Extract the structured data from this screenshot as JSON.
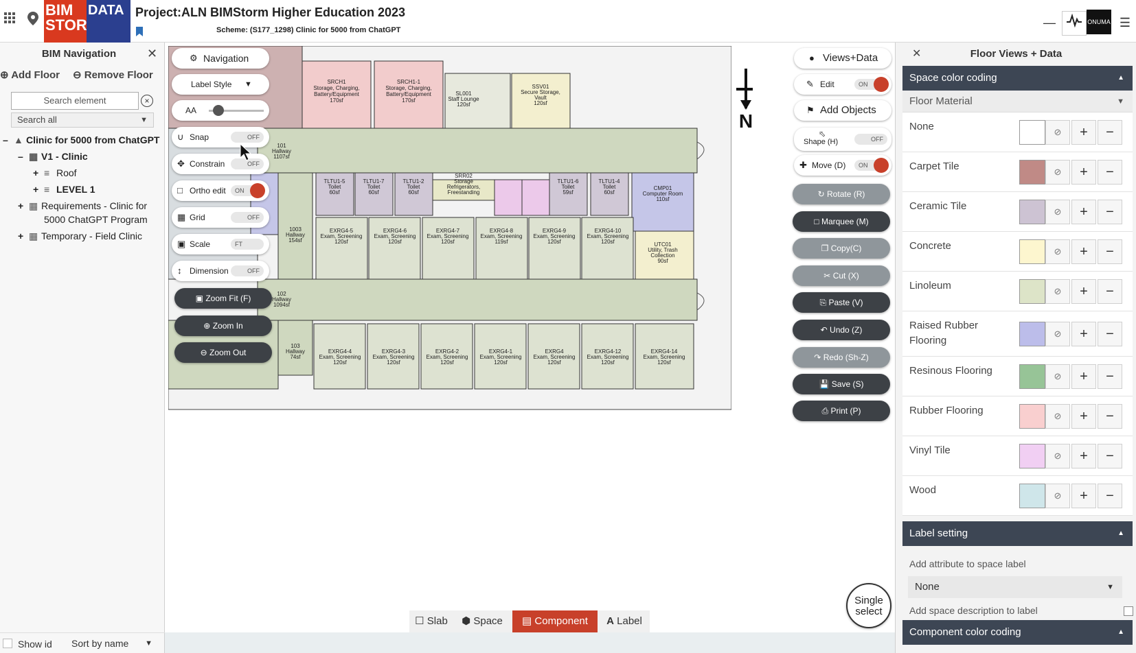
{
  "header": {
    "project_title": "Project:ALN BIMStorm Higher Education 2023",
    "scheme": "Scheme: (S177_1298) Clinic for 5000 from ChatGPT",
    "logo_left": "BIM STORM",
    "logo_right": "DATA",
    "right_logo": "ONUMA"
  },
  "bim_navigation": {
    "title": "BIM Navigation",
    "add_floor": "Add Floor",
    "remove_floor": "Remove Floor",
    "search_placeholder": "Search element",
    "search_scope": "Search all",
    "tree": [
      {
        "toggle": "–",
        "label": "Clinic for 5000 from ChatGPT",
        "bold": true
      },
      {
        "toggle": "–",
        "label": "V1 - Clinic",
        "bold": true
      },
      {
        "toggle": "+",
        "label": "Roof",
        "bold": false
      },
      {
        "toggle": "+",
        "label": "LEVEL 1",
        "bold": true
      },
      {
        "toggle": "+",
        "label": "Requirements - Clinic for",
        "label2": "5000 ChatGPT Program",
        "bold": false
      },
      {
        "toggle": "+",
        "label": "Temporary - Field Clinic",
        "bold": false
      }
    ],
    "show_id": "Show id",
    "sort_by": "Sort by name"
  },
  "left_toolbar": {
    "navigation": "Navigation",
    "label_style": "Label Style",
    "font_size_label": "AA",
    "snap": {
      "label": "Snap",
      "state": "OFF"
    },
    "constrain": {
      "label": "Constrain",
      "state": "OFF"
    },
    "ortho_edit": {
      "label": "Ortho edit",
      "state": "ON"
    },
    "grid": {
      "label": "Grid",
      "state": "OFF"
    },
    "scale": {
      "label": "Scale",
      "state": "FT"
    },
    "dimension": {
      "label": "Dimension",
      "state": "OFF"
    },
    "zoom_fit": "Zoom Fit (F)",
    "zoom_in": "Zoom In",
    "zoom_out": "Zoom Out"
  },
  "right_toolbar": {
    "views_data": "Views+Data",
    "edit": {
      "label": "Edit",
      "state": "ON"
    },
    "add_objects": "Add Objects",
    "shape": {
      "label": "Shape (H)",
      "state": "OFF"
    },
    "move": {
      "label": "Move (D)",
      "state": "ON"
    },
    "rotate": "Rotate (R)",
    "marquee": "Marquee (M)",
    "copy": "Copy(C)",
    "cut": "Cut (X)",
    "paste": "Paste (V)",
    "undo": "Undo (Z)",
    "redo": "Redo (Sh-Z)",
    "save": "Save (S)",
    "print": "Print (P)"
  },
  "single_select": {
    "line1": "Single",
    "line2": "select"
  },
  "mode_bar": [
    {
      "label": "Slab",
      "active": false
    },
    {
      "label": "Space",
      "active": false
    },
    {
      "label": "Component",
      "active": true
    },
    {
      "label": "Label",
      "active": false
    }
  ],
  "north_label": "N",
  "floorplan": {
    "rooms": [
      {
        "id": "SRCH1",
        "line2": "Storage, Charging,",
        "line3": "Battery/Equipment",
        "line4": "170sf"
      },
      {
        "id": "SRCH1-1",
        "line2": "Storage, Charging,",
        "line3": "Battery/Equipment",
        "line4": "170sf"
      },
      {
        "id": "SL001",
        "line2": "Staff Lounge",
        "line3": "120sf"
      },
      {
        "id": "SSV01",
        "line2": "Secure Storage,",
        "line3": "Vault",
        "line4": "120sf"
      },
      {
        "id": "101",
        "line2": "Hallway",
        "line3": "1107sf"
      },
      {
        "id": "TLTU1-5",
        "line2": "Toilet",
        "line3": "60sf"
      },
      {
        "id": "TLTU1-7",
        "line2": "Toilet",
        "line3": "60sf"
      },
      {
        "id": "TLTU1-2",
        "line2": "Toilet",
        "line3": "60sf"
      },
      {
        "id": "SRR02",
        "line2": "Storage",
        "line3": "Refrigerators,",
        "line4": "Freestanding"
      },
      {
        "id": "TLTU1-6",
        "line2": "Toilet",
        "line3": "59sf"
      },
      {
        "id": "TLTU1-4",
        "line2": "Toilet",
        "line3": "60sf"
      },
      {
        "id": "CMP01",
        "line2": "Computer Room",
        "line3": "110sf"
      },
      {
        "id": "1003",
        "line2": "Hallway",
        "line3": "154sf"
      },
      {
        "id": "EXRG4-5",
        "line2": "Exam, Screening",
        "line3": "120sf"
      },
      {
        "id": "EXRG4-6",
        "line2": "Exam, Screening",
        "line3": "120sf"
      },
      {
        "id": "EXRG4-7",
        "line2": "Exam, Screening",
        "line3": "120sf"
      },
      {
        "id": "EXRG4-8",
        "line2": "Exam, Screening",
        "line3": "119sf"
      },
      {
        "id": "EXRG4-9",
        "line2": "Exam, Screening",
        "line3": "120sf"
      },
      {
        "id": "EXRG4-10",
        "line2": "Exam, Screening",
        "line3": "120sf"
      },
      {
        "id": "UTC01",
        "line2": "Utility, Trash",
        "line3": "Collection",
        "line4": "90sf"
      },
      {
        "id": "102",
        "line2": "Hallway",
        "line3": "1094sf"
      },
      {
        "id": "103",
        "line2": "Hallway",
        "line3": "74sf"
      },
      {
        "id": "EXRG4-4",
        "line2": "Exam, Screening",
        "line3": "120sf"
      },
      {
        "id": "EXRG4-3",
        "line2": "Exam, Screening",
        "line3": "120sf"
      },
      {
        "id": "EXRG4-2",
        "line2": "Exam, Screening",
        "line3": "120sf"
      },
      {
        "id": "EXRG4-1",
        "line2": "Exam, Screening",
        "line3": "120sf"
      },
      {
        "id": "EXRG4",
        "line2": "Exam, Screening",
        "line3": "120sf"
      },
      {
        "id": "EXRG4-12",
        "line2": "Exam, Screening",
        "line3": "120sf"
      },
      {
        "id": "EXRG4-14",
        "line2": "Exam, Screening",
        "line3": "120sf"
      }
    ]
  },
  "floor_views": {
    "title": "Floor Views + Data",
    "space_color_coding": "Space color coding",
    "floor_material": "Floor Material",
    "materials": [
      {
        "name": "None",
        "color": "#ffffff"
      },
      {
        "name": "Carpet Tile",
        "color": "#c08a86"
      },
      {
        "name": "Ceramic Tile",
        "color": "#cdc3d3"
      },
      {
        "name": "Concrete",
        "color": "#fdf6cf"
      },
      {
        "name": "Linoleum",
        "color": "#dde4c8"
      },
      {
        "name": "Raised Rubber Flooring",
        "color": "#bcbdea"
      },
      {
        "name": "Resinous Flooring",
        "color": "#97c497"
      },
      {
        "name": "Rubber Flooring",
        "color": "#f9cfcf"
      },
      {
        "name": "Vinyl Tile",
        "color": "#f1cff3"
      },
      {
        "name": "Wood",
        "color": "#cfe6ea"
      }
    ],
    "label_setting": "Label setting",
    "add_attribute_label": "Add attribute to space label",
    "attribute_value": "None",
    "add_description_label": "Add space description to label",
    "component_color_coding": "Component color coding"
  }
}
